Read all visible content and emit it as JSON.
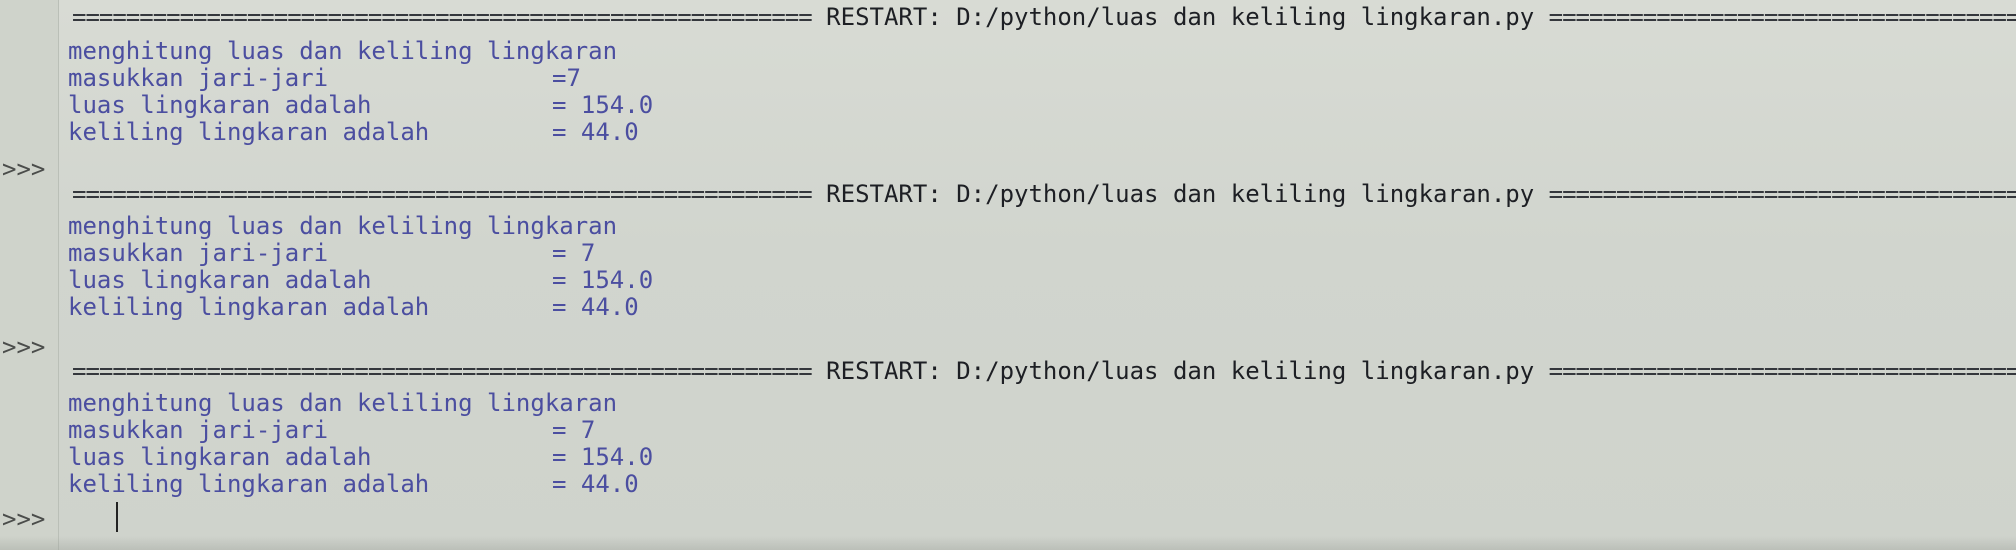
{
  "gutter": {
    "prompt_symbol": ">>>"
  },
  "sessions": [
    {
      "separator_left": "=======================================================",
      "separator_center": "RESTART: D:/python/luas dan keliling lingkaran.py",
      "separator_right": "===========================================================",
      "output": {
        "heading": "menghitung luas dan keliling lingkaran",
        "rows": [
          {
            "label": "masukkan jari-jari",
            "value": "=7"
          },
          {
            "label": "luas lingkaran adalah",
            "value": "= 154.0"
          },
          {
            "label": "keliling lingkaran adalah",
            "value": "= 44.0"
          }
        ]
      }
    },
    {
      "separator_left": "=======================================================",
      "separator_center": "RESTART: D:/python/luas dan keliling lingkaran.py",
      "separator_right": "===========================================================",
      "output": {
        "heading": "menghitung luas dan keliling lingkaran",
        "rows": [
          {
            "label": "masukkan jari-jari",
            "value": "= 7"
          },
          {
            "label": "luas lingkaran adalah",
            "value": "= 154.0"
          },
          {
            "label": "keliling lingkaran adalah",
            "value": "= 44.0"
          }
        ]
      }
    },
    {
      "separator_left": "=======================================================",
      "separator_center": "RESTART: D:/python/luas dan keliling lingkaran.py",
      "separator_right": "===========================================================",
      "output": {
        "heading": "menghitung luas dan keliling lingkaran",
        "rows": [
          {
            "label": "masukkan jari-jari",
            "value": "= 7"
          },
          {
            "label": "luas lingkaran adalah",
            "value": "= 154.0"
          },
          {
            "label": "keliling lingkaran adalah",
            "value": "= 44.0"
          }
        ]
      }
    }
  ]
}
